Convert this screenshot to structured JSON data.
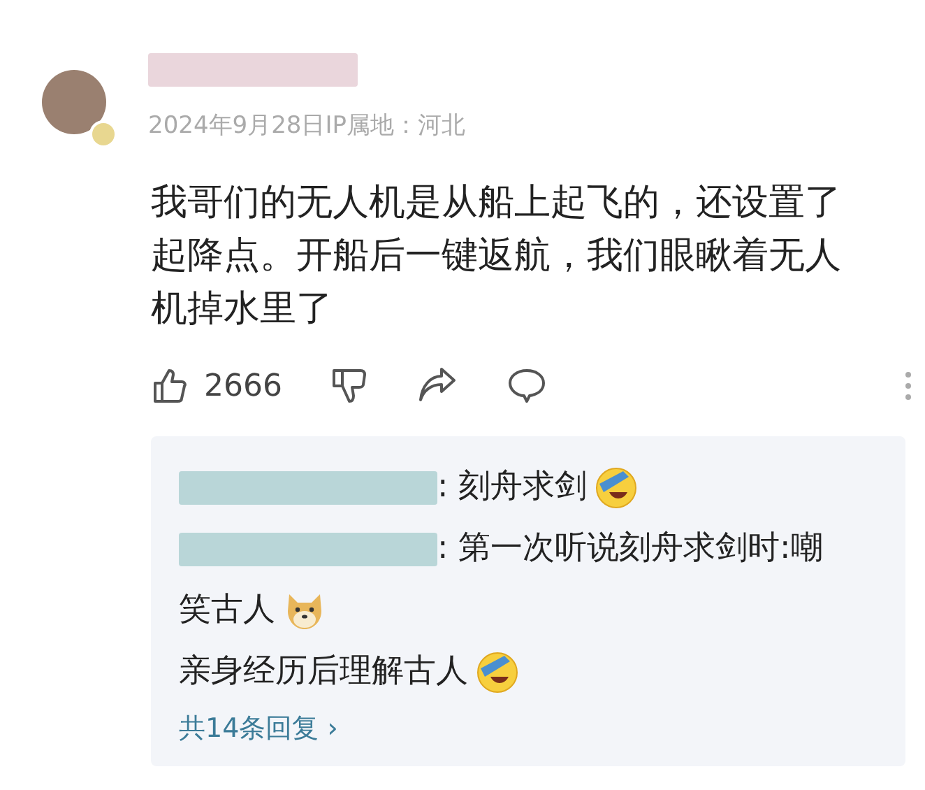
{
  "comment": {
    "date": "2024年9月28日IP属地：河北",
    "body": "我哥们的无人机是从船上起飞的，还设置了起降点。开船后一键返航，我们眼瞅着无人机掉水里了",
    "likes": "2666"
  },
  "replies": [
    {
      "text": ": 刻舟求剑",
      "emoji": {
        "kind": "laugh"
      }
    },
    {
      "text": ": 第一次听说刻舟求剑时:嘲"
    },
    {
      "text": "笑古人",
      "emoji": {
        "kind": "doge"
      },
      "kind": "continuation"
    },
    {
      "text": "亲身经历后理解古人",
      "emoji": {
        "kind": "laugh"
      },
      "kind": "continuation"
    }
  ],
  "more_replies": "共14条回复 ›"
}
